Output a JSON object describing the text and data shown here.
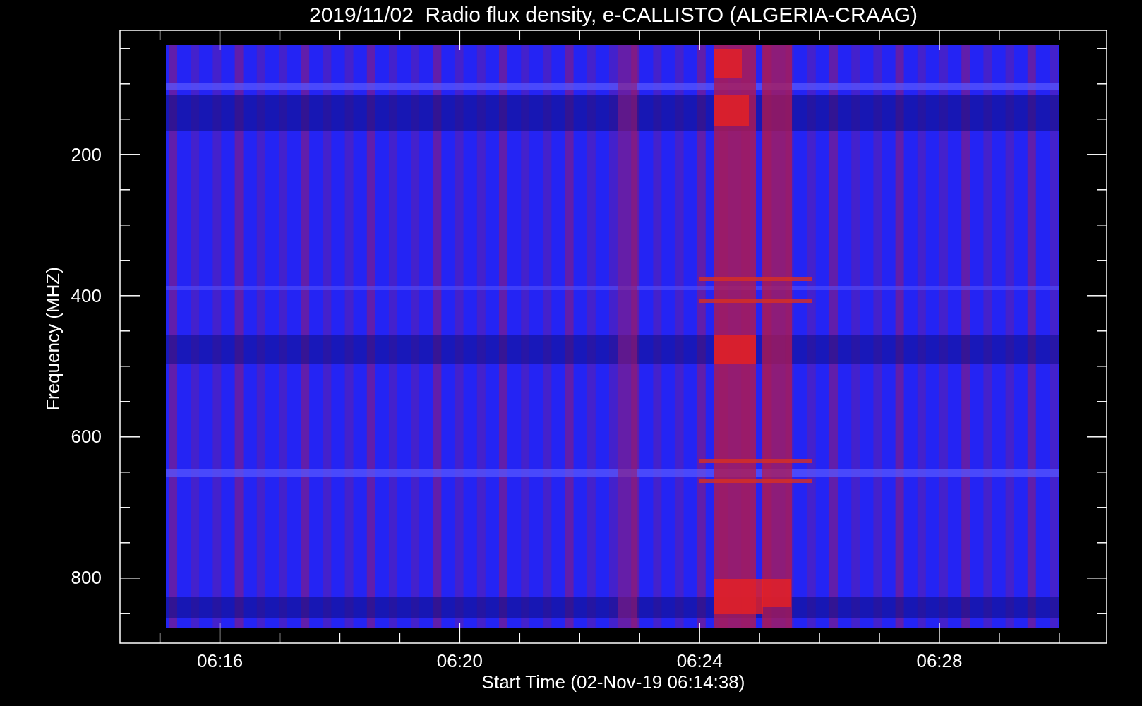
{
  "title": "2019/11/02  Radio flux density, e-CALLISTO (ALGERIA-CRAAG)",
  "plot": {
    "ylabel": "Frequency (MHZ)",
    "xlabel": "Start Time (02-Nov-19 06:14:38)",
    "yticks": [
      "200",
      "400",
      "600",
      "800"
    ],
    "xticks": [
      "06:16",
      "06:20",
      "06:24",
      "06:28"
    ]
  }
}
